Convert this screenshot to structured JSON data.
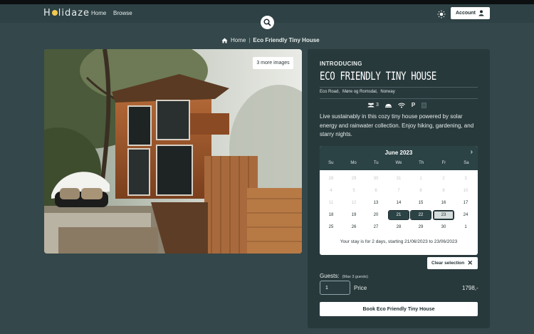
{
  "nav": {
    "logo_text": "H",
    "logo_text_2": "lidaze",
    "links": [
      "Home",
      "Browse"
    ],
    "account_label": "Account"
  },
  "breadcrumb": {
    "home": "Home",
    "current": "Eco Friendly Tiny House"
  },
  "gallery": {
    "more_images_label": "3 more images"
  },
  "listing": {
    "introducing": "INTRODUCING",
    "title": "ECO FRIENDLY TINY HOUSE",
    "address": [
      "Eco Road,",
      "Møre og Romsdal,",
      "Norway"
    ],
    "guests_icon_value": "3",
    "parking_label": "P",
    "description": "Live sustainably in this cozy tiny house powered by solar energy and rainwater collection. Enjoy hiking, gardening, and starry nights."
  },
  "calendar": {
    "month": "June 2023",
    "weekdays": [
      "Su",
      "Mo",
      "Tu",
      "We",
      "Th",
      "Fr",
      "Sa"
    ],
    "weeks": [
      [
        "28",
        "29",
        "30",
        "31",
        "1",
        "2",
        "3"
      ],
      [
        "4",
        "5",
        "6",
        "7",
        "8",
        "9",
        "10"
      ],
      [
        "11",
        "12",
        "13",
        "14",
        "15",
        "16",
        "17"
      ],
      [
        "18",
        "19",
        "20",
        "21",
        "22",
        "23",
        "24"
      ],
      [
        "25",
        "26",
        "27",
        "28",
        "29",
        "30",
        "1"
      ]
    ],
    "stay_text": "Your stay is for 2 days, starting 21/06/2023 to 23/06/2023"
  },
  "booking": {
    "clear_label": "Clear selection",
    "guests_label": "Guests:",
    "guests_hint": "(Max 3 guests)",
    "guests_value": "1",
    "price_label": "Price",
    "price_value": "1798,-",
    "book_label": "Book Eco Friendly Tiny House"
  }
}
